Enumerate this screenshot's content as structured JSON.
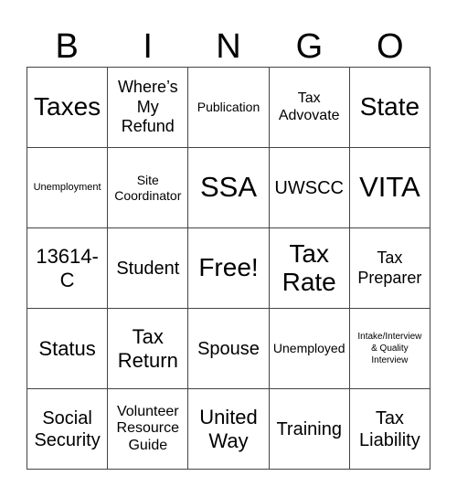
{
  "header": {
    "letters": [
      "B",
      "I",
      "N",
      "G",
      "O"
    ]
  },
  "grid": {
    "rows": [
      [
        "Taxes",
        "Where’s\nMy\nRefund",
        "Publication",
        "Tax\nAdvovate",
        "State"
      ],
      [
        "Unemployment",
        "Site\nCoordinator",
        "SSA",
        "UWSCC",
        "VITA"
      ],
      [
        "13614-\nC",
        "Student",
        "Free!",
        "Tax\nRate",
        "Tax\nPreparer"
      ],
      [
        "Status",
        "Tax\nReturn",
        "Spouse",
        "Unemployed",
        "Intake/Interview\n& Quality\nInterview"
      ],
      [
        "Social\nSecurity",
        "Volunteer\nResource\nGuide",
        "United\nWay",
        "Training",
        "Tax\nLiability"
      ]
    ]
  }
}
